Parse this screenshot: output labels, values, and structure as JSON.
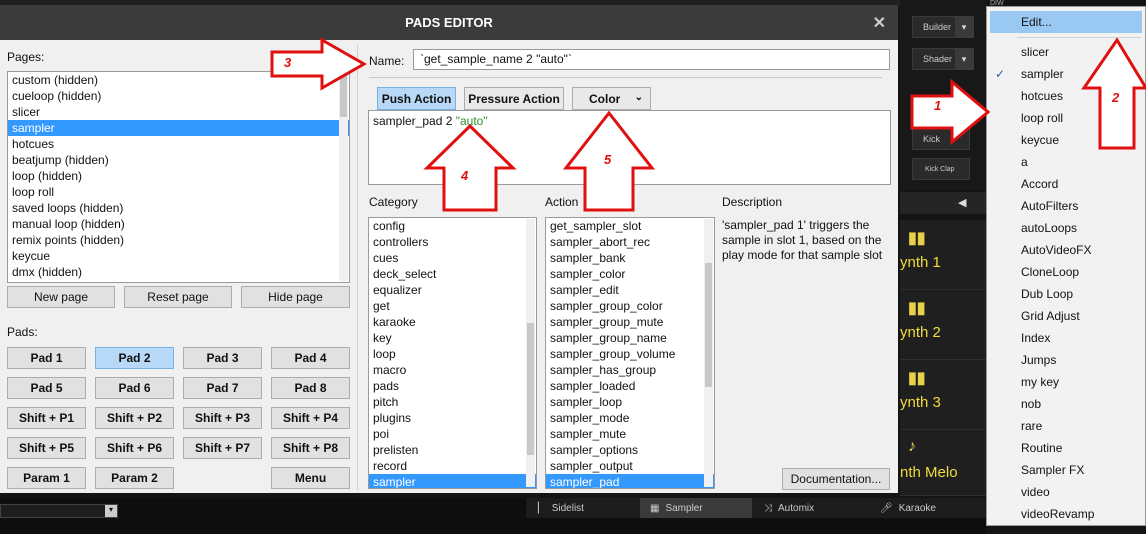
{
  "background": {
    "top_tab": "DIW",
    "builder_label": "Builder",
    "shader_label": "Shader",
    "kick_label": "Kick",
    "kick_clap_label": "Kick Clap",
    "synths": [
      "ynth 1",
      "ynth 2",
      "ynth 3",
      "nth Melo"
    ],
    "bottom_tabs": [
      {
        "label": "Sidelist"
      },
      {
        "label": "Sampler"
      },
      {
        "label": "Automix"
      },
      {
        "label": "Karaoke"
      }
    ]
  },
  "dialog": {
    "title": "PADS EDITOR",
    "close": "✕",
    "pages_label": "Pages:",
    "pages": [
      "custom (hidden)",
      "cueloop (hidden)",
      "slicer",
      "sampler",
      "hotcues",
      "beatjump (hidden)",
      "loop (hidden)",
      "loop roll",
      "saved loops (hidden)",
      "manual loop (hidden)",
      "remix points (hidden)",
      "keycue",
      "dmx (hidden)"
    ],
    "selected_page": "sampler",
    "page_buttons": [
      "New page",
      "Reset page",
      "Hide page"
    ],
    "pads_label": "Pads:",
    "pads": [
      [
        "Pad 1",
        "Pad 2",
        "Pad 3",
        "Pad 4"
      ],
      [
        "Pad 5",
        "Pad 6",
        "Pad 7",
        "Pad 8"
      ],
      [
        "Shift + P1",
        "Shift + P2",
        "Shift + P3",
        "Shift + P4"
      ],
      [
        "Shift + P5",
        "Shift + P6",
        "Shift + P7",
        "Shift + P8"
      ],
      [
        "Param 1",
        "Param 2",
        "",
        "Menu"
      ]
    ],
    "active_pad": "Pad 2",
    "name_label": "Name:",
    "name_value": "`get_sample_name 2 \"auto\"`",
    "tabs": {
      "push": "Push Action",
      "pressure": "Pressure Action",
      "color": "Color"
    },
    "script_cmd": "sampler_pad 2 ",
    "script_str": "\"auto\"",
    "category_label": "Category",
    "categories": [
      "config",
      "controllers",
      "cues",
      "deck_select",
      "equalizer",
      "get",
      "karaoke",
      "key",
      "loop",
      "macro",
      "pads",
      "pitch",
      "plugins",
      "poi",
      "prelisten",
      "record",
      "sampler"
    ],
    "selected_category": "sampler",
    "action_label": "Action",
    "actions": [
      "get_sampler_slot",
      "sampler_abort_rec",
      "sampler_bank",
      "sampler_color",
      "sampler_edit",
      "sampler_group_color",
      "sampler_group_mute",
      "sampler_group_name",
      "sampler_group_volume",
      "sampler_has_group",
      "sampler_loaded",
      "sampler_loop",
      "sampler_mode",
      "sampler_mute",
      "sampler_options",
      "sampler_output",
      "sampler_pad"
    ],
    "selected_action": "sampler_pad",
    "description_label": "Description",
    "description_text": "'sampler_pad 1' triggers the sample in slot 1, based on the play mode for that sample slot",
    "documentation_button": "Documentation..."
  },
  "menu": {
    "items": [
      "Edit...",
      "slicer",
      "sampler",
      "hotcues",
      "loop roll",
      "keycue",
      "a",
      "Accord",
      "AutoFilters",
      "autoLoops",
      "AutoVideoFX",
      "CloneLoop",
      "Dub Loop",
      "Grid Adjust",
      "Index",
      "Jumps",
      "my key",
      "nob",
      "rare",
      "Routine",
      "Sampler FX",
      "video",
      "videoRevamp"
    ],
    "highlighted": "Edit...",
    "checked": "sampler"
  },
  "annotations": [
    "1",
    "2",
    "3",
    "4",
    "5"
  ],
  "colors": {
    "accent": "#3399ff",
    "arrow": "#e01010",
    "pad_active": "#b7d8f6",
    "string_green": "#2e8b2e",
    "title_bar": "#3b3b3b"
  }
}
